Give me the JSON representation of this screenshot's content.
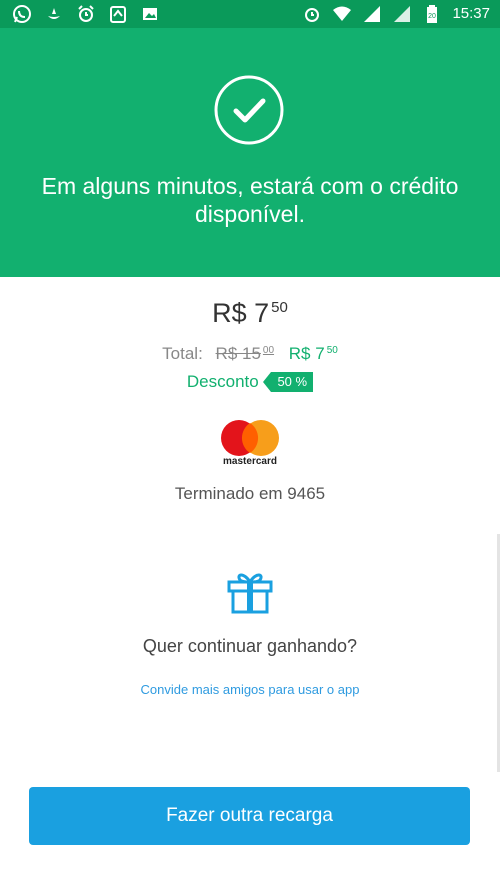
{
  "status_bar": {
    "time": "15:37",
    "battery_level": "20",
    "left_icons": [
      "whatsapp-icon",
      "app-icon",
      "alarm-icon",
      "clipboard-icon",
      "image-icon"
    ],
    "right_icons": [
      "alarm-icon",
      "wifi-icon",
      "signal-icon",
      "signal-icon",
      "battery-icon"
    ]
  },
  "hero": {
    "message": "Em alguns minutos, estará com o crédito disponível.",
    "icon": "checkmark-circle-icon",
    "color": "#12b06f"
  },
  "summary": {
    "price_main": "R$ 7",
    "price_cents": "50",
    "total_label": "Total:",
    "old_price_main": "R$ 15",
    "old_price_cents": "00",
    "new_price_main": "R$ 7",
    "new_price_cents": "50",
    "discount_label": "Desconto",
    "discount_badge": "50 %"
  },
  "payment": {
    "brand": "mastercard",
    "terminado": "Terminado em 9465"
  },
  "promo": {
    "icon": "gift-icon",
    "question": "Quer continuar ganhando?",
    "invite_link": "Convide mais amigos para usar o app"
  },
  "actions": {
    "cta_label": "Fazer outra recarga",
    "cta_color": "#1aa0e0"
  }
}
